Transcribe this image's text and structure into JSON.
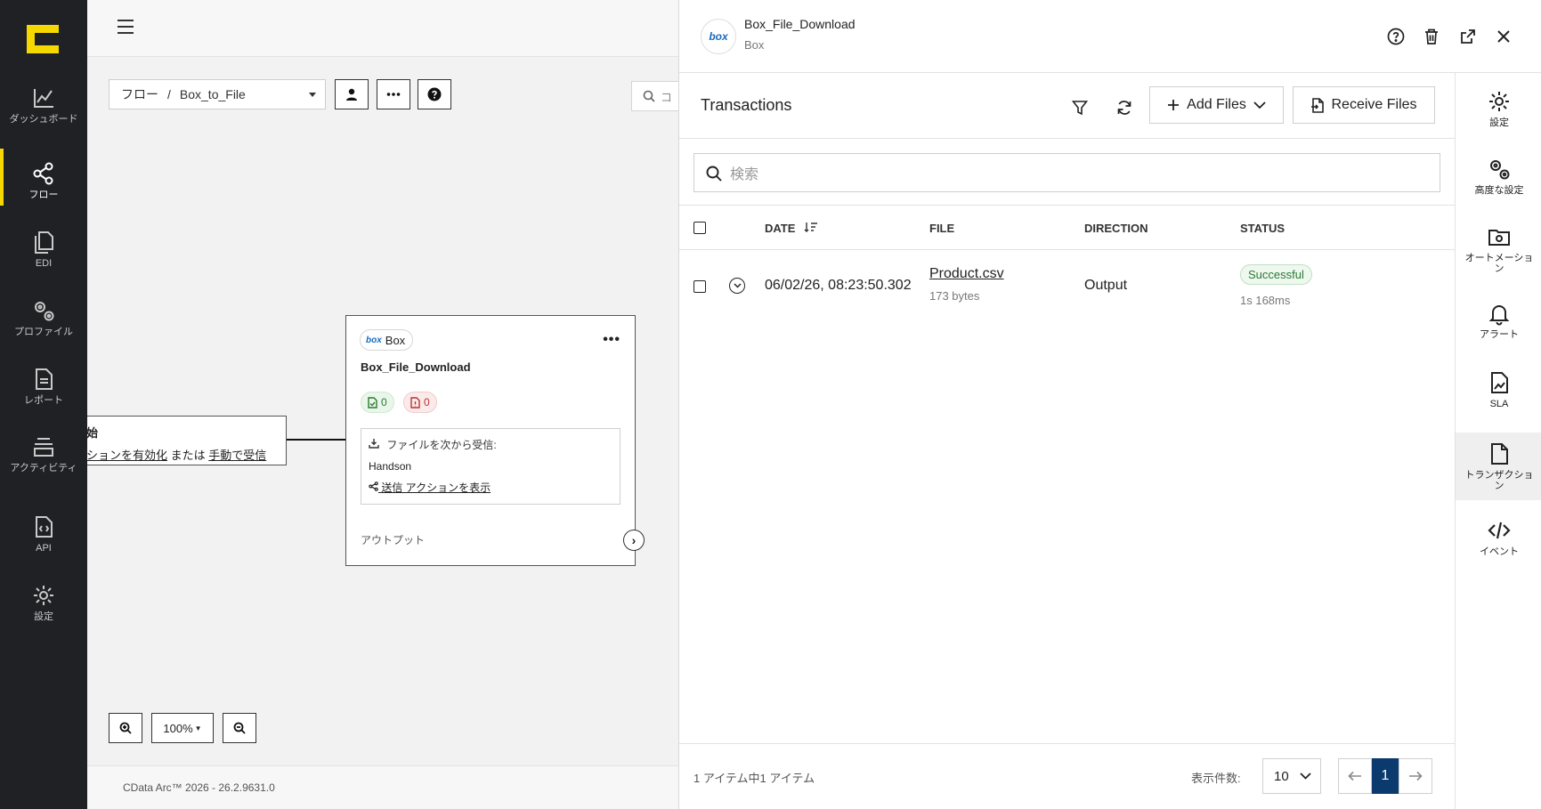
{
  "nav": {
    "items": [
      {
        "label": "ダッシュボード",
        "icon": "chart-line-icon"
      },
      {
        "label": "フロー",
        "icon": "share-nodes-icon"
      },
      {
        "label": "EDI",
        "icon": "documents-icon"
      },
      {
        "label": "プロファイル",
        "icon": "gears-icon"
      },
      {
        "label": "レポート",
        "icon": "report-icon"
      },
      {
        "label": "アクティビティ",
        "icon": "stack-icon"
      },
      {
        "label": "API",
        "icon": "api-file-icon"
      },
      {
        "label": "設定",
        "icon": "gear-icon"
      }
    ],
    "active_index": 1,
    "accent": "#f5d800"
  },
  "canvas": {
    "breadcrumb_root": "フロー",
    "breadcrumb_sep": "/",
    "breadcrumb_flow": "Box_to_File",
    "search_stub": "コ",
    "start_node": {
      "line1": "始",
      "pre_link1": "ション",
      "link1": "を有効化",
      "mid": " または ",
      "link2": "手動で受信"
    },
    "node": {
      "connector": "Box",
      "connector_logo": "box",
      "title": "Box_File_Download",
      "success_count": "0",
      "error_count": "0",
      "receive_label": "ファイルを次から受信:",
      "receive_source": "Handson",
      "send_action_link": "送信 アクションを表示",
      "output_label": "アウトプット",
      "menu": "•••"
    },
    "zoom_level": "100%",
    "footer": "CData Arc™ 2026 - 26.2.9631.0"
  },
  "panel": {
    "title": "Box_File_Download",
    "subtitle": "Box",
    "logo_text": "box",
    "transactions_title": "Transactions",
    "add_files": "Add Files",
    "receive_files": "Receive Files",
    "search_placeholder": "検索",
    "columns": {
      "date": "DATE",
      "file": "FILE",
      "direction": "DIRECTION",
      "status": "STATUS"
    },
    "rows": [
      {
        "date": "06/02/26, 08:23:50.302",
        "file": "Product.csv",
        "size": "173 bytes",
        "direction": "Output",
        "status": "Successful",
        "duration": "1s 168ms"
      }
    ],
    "pager": {
      "info": "1 アイテム中1 アイテム",
      "page_size_label": "表示件数:",
      "page_size": "10",
      "current_page": "1"
    }
  },
  "rside": {
    "items": [
      {
        "label": "設定",
        "icon": "gear-icon"
      },
      {
        "label": "高度な設定",
        "icon": "gears-icon"
      },
      {
        "label": "オートメーション",
        "icon": "folder-gear-icon"
      },
      {
        "label": "アラート",
        "icon": "bell-icon"
      },
      {
        "label": "SLA",
        "icon": "sla-file-icon"
      },
      {
        "label": "トランザクション",
        "icon": "file-icon"
      },
      {
        "label": "イベント",
        "icon": "code-icon"
      }
    ],
    "active_index": 5
  }
}
